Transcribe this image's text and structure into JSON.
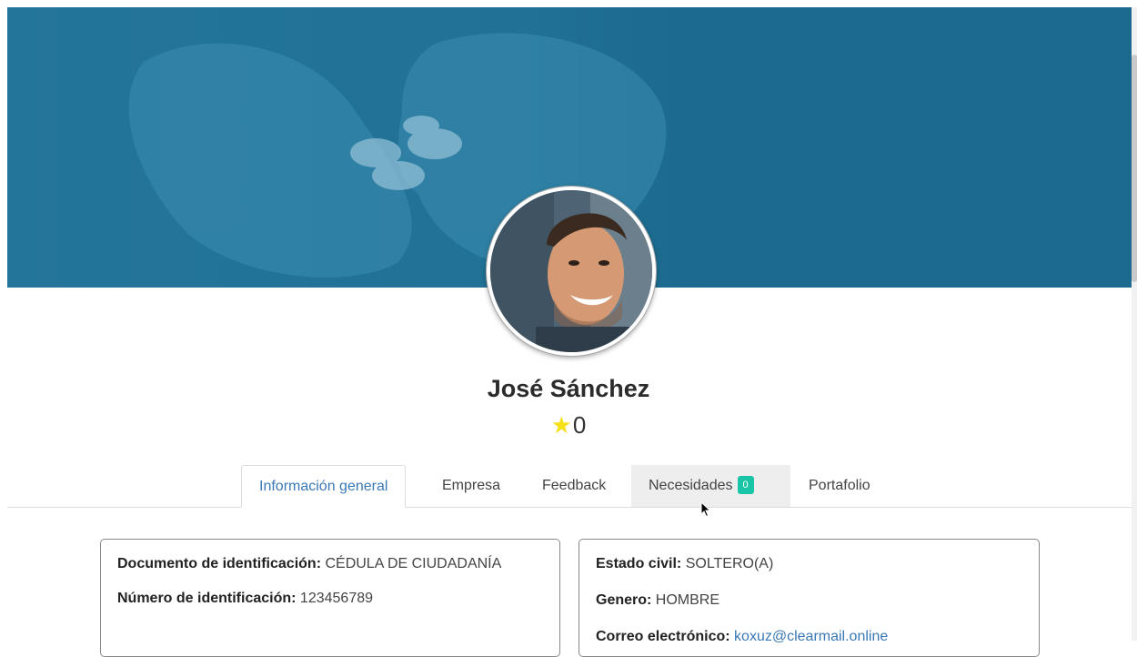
{
  "profile": {
    "name": "José Sánchez",
    "rating": "0",
    "star_icon": "star-icon",
    "star_color": "#f5e01a"
  },
  "tabs": [
    {
      "label": "Información general",
      "active": true
    },
    {
      "label": "Empresa"
    },
    {
      "label": "Feedback"
    },
    {
      "label": "Necesidades",
      "badge": "0"
    },
    {
      "label": "Portafolio"
    }
  ],
  "info_left": {
    "doc_label": "Documento de identificación:",
    "doc_value": "CÉDULA DE CIUDADANÍA",
    "id_label": "Número de identificación:",
    "id_value": "123456789"
  },
  "info_right": {
    "civil_label": "Estado civil:",
    "civil_value": "SOLTERO(A)",
    "gender_label": "Genero:",
    "gender_value": "HOMBRE",
    "email_label": "Correo electrónico:",
    "email_value": "koxuz@clearmail.online"
  },
  "colors": {
    "banner": "#1c6a8e",
    "accent": "#3a78b5",
    "badge": "#19c5a6"
  }
}
